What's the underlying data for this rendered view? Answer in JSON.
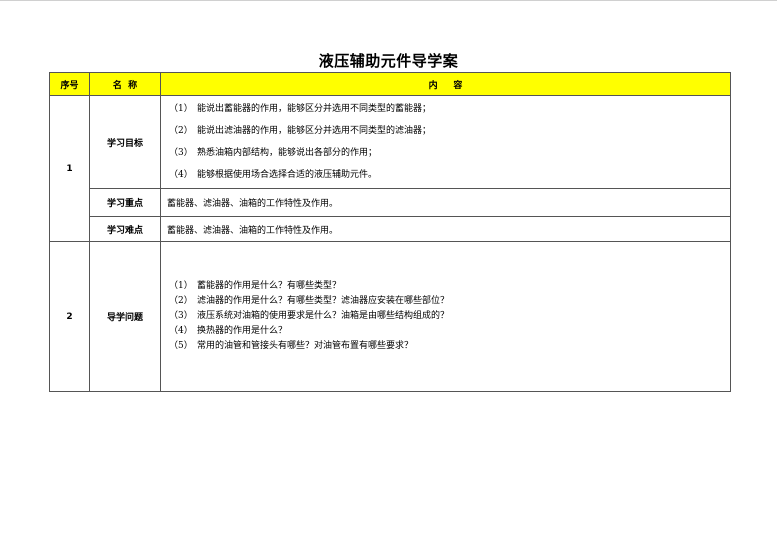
{
  "document": {
    "title": "液压辅助元件导学案",
    "headers": {
      "no": "序号",
      "name": "名  称",
      "content": "内     容"
    },
    "section1": {
      "no": "1",
      "goals": {
        "label": "学习目标",
        "items": [
          {
            "num": "（1）",
            "text": "能说出蓄能器的作用，能够区分并选用不同类型的蓄能器；"
          },
          {
            "num": "（2）",
            "text": "能说出滤油器的作用，能够区分并选用不同类型的滤油器；"
          },
          {
            "num": "（3）",
            "text": "熟悉油箱内部结构，能够说出各部分的作用；"
          },
          {
            "num": "（4）",
            "text": "能够根据使用场合选择合适的液压辅助元件。"
          }
        ]
      },
      "key_points": {
        "label": "学习重点",
        "text": "蓄能器、滤油器、油箱的工作特性及作用。"
      },
      "difficulties": {
        "label": "学习难点",
        "text": "蓄能器、滤油器、油箱的工作特性及作用。"
      }
    },
    "section2": {
      "no": "2",
      "label": "导学问题",
      "items": [
        {
          "num": "（1）",
          "text": "蓄能器的作用是什么？有哪些类型？"
        },
        {
          "num": "（2）",
          "text": "滤油器的作用是什么？有哪些类型？滤油器应安装在哪些部位？"
        },
        {
          "num": "（3）",
          "text": "液压系统对油箱的使用要求是什么？油箱是由哪些结构组成的？"
        },
        {
          "num": "（4）",
          "text": "换热器的作用是什么？"
        },
        {
          "num": "（5）",
          "text": "常用的油管和管接头有哪些？对油管布置有哪些要求？"
        }
      ]
    },
    "colors": {
      "header_bg": "#ffff00",
      "border": "#555555"
    }
  }
}
